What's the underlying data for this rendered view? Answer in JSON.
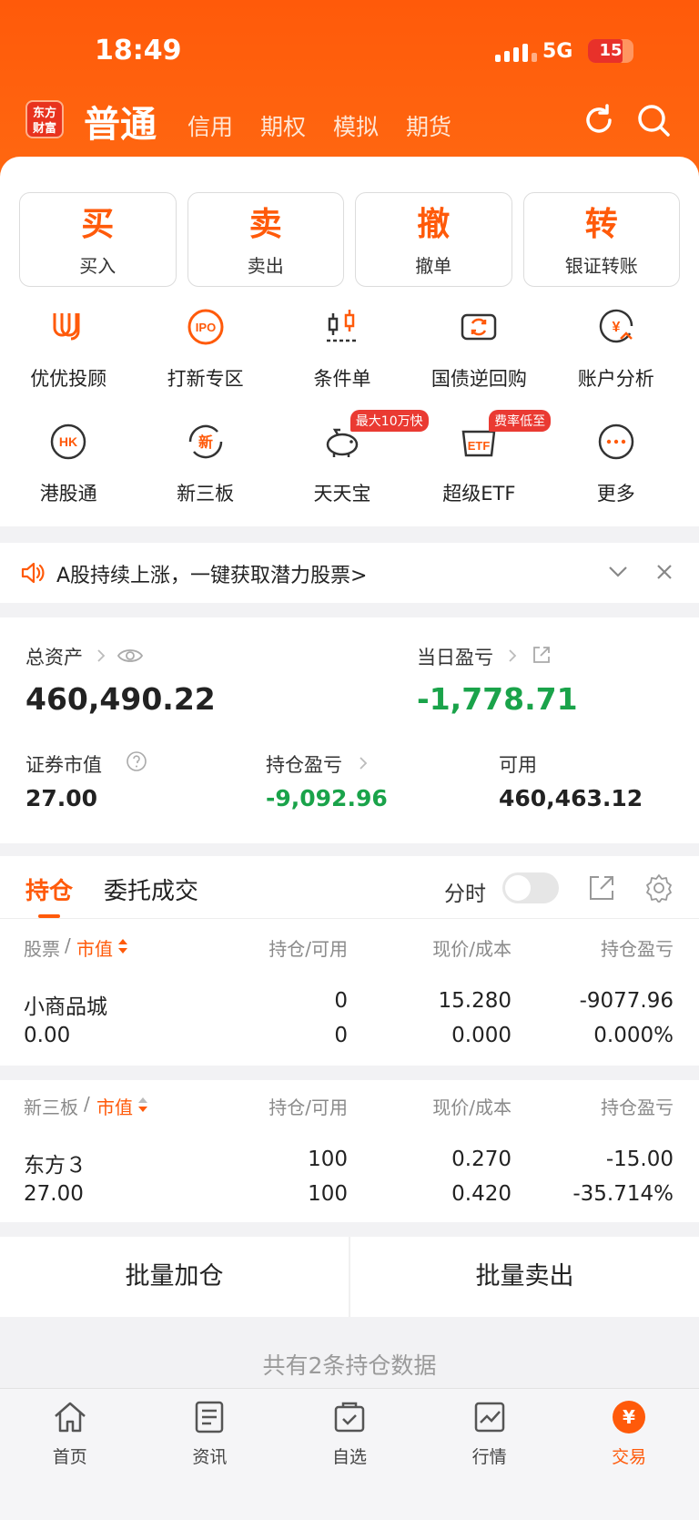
{
  "status_bar": {
    "time": "18:49",
    "network": "5G",
    "battery": "15"
  },
  "header": {
    "logo_text": "东方财富",
    "tabs": [
      "普通",
      "信用",
      "期权",
      "模拟",
      "期货"
    ]
  },
  "actions": [
    {
      "big": "买",
      "small": "买入"
    },
    {
      "big": "卖",
      "small": "卖出"
    },
    {
      "big": "撤",
      "small": "撤单"
    },
    {
      "big": "转",
      "small": "银证转账"
    }
  ],
  "grid_row1": [
    {
      "label": "优优投顾",
      "icon": "uu-advisor-icon"
    },
    {
      "label": "打新专区",
      "icon": "ipo-icon",
      "icon_text": "IPO"
    },
    {
      "label": "条件单",
      "icon": "condition-order-icon"
    },
    {
      "label": "国债逆回购",
      "icon": "reverse-repo-icon"
    },
    {
      "label": "账户分析",
      "icon": "account-analysis-icon",
      "icon_text": "¥"
    }
  ],
  "grid_row2": [
    {
      "label": "港股通",
      "icon": "hk-connect-icon",
      "icon_text": "HK"
    },
    {
      "label": "新三板",
      "icon": "new-otc-icon",
      "icon_text": "新"
    },
    {
      "label": "天天宝",
      "icon": "piggy-bank-icon",
      "badge": "最大10万快"
    },
    {
      "label": "超级ETF",
      "icon": "etf-icon",
      "icon_text": "ETF",
      "badge": "费率低至"
    },
    {
      "label": "更多",
      "icon": "more-icon"
    }
  ],
  "notice": {
    "text": "A股持续上涨，一键获取潜力股票>"
  },
  "assets": {
    "total_label": "总资产",
    "total_value": "460,490.22",
    "daily_pl_label": "当日盈亏",
    "daily_pl_value": "-1,778.71",
    "market_value_label": "证券市值",
    "market_value": "27.00",
    "position_pl_label": "持仓盈亏",
    "position_pl_value": "-9,092.96",
    "available_label": "可用",
    "available_value": "460,463.12"
  },
  "holdings_tabs": {
    "active": "持仓",
    "other": "委托成交",
    "timeshare": "分时"
  },
  "table1": {
    "headers": {
      "stock": "股票",
      "sort": "市值",
      "pos": "持仓/可用",
      "price": "现价/成本",
      "pl": "持仓盈亏"
    },
    "row": {
      "name": "小商品城",
      "mv": "0.00",
      "pos": "0",
      "avail": "0",
      "price": "15.280",
      "cost": "0.000",
      "pl": "-9077.96",
      "pl_pct": "0.000%"
    }
  },
  "table2": {
    "headers": {
      "stock": "新三板",
      "sort": "市值",
      "pos": "持仓/可用",
      "price": "现价/成本",
      "pl": "持仓盈亏"
    },
    "row": {
      "name": "东方３",
      "mv": "27.00",
      "pos": "100",
      "avail": "100",
      "price": "0.270",
      "cost": "0.420",
      "pl": "-15.00",
      "pl_pct": "-35.714%"
    }
  },
  "batch": {
    "add": "批量加仓",
    "sell": "批量卖出"
  },
  "count_text": "共有2条持仓数据",
  "bottom_nav": [
    {
      "label": "首页",
      "icon": "home-icon"
    },
    {
      "label": "资讯",
      "icon": "news-icon"
    },
    {
      "label": "自选",
      "icon": "watchlist-icon"
    },
    {
      "label": "行情",
      "icon": "market-icon"
    },
    {
      "label": "交易",
      "icon": "trade-icon",
      "icon_text": "¥"
    }
  ],
  "colors": {
    "brand": "#ff5a0a",
    "gain_loss_green": "#1aa34a",
    "badge_red": "#ea3a32"
  }
}
